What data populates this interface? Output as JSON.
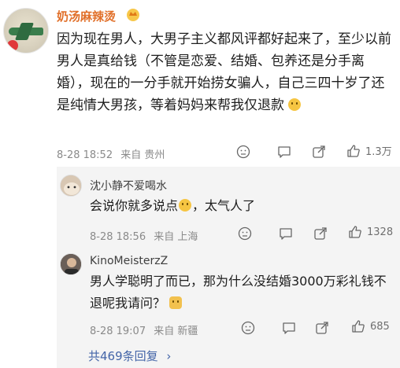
{
  "comment": {
    "username": "奶汤麻辣烫",
    "text": "因为现在男人，大男子主义都风评都好起来了，至少以前男人是真给钱（不管是恋爱、结婚、包养还是分手离婚），现在的一分手就开始捞女骗人，自己三四十岁了还是纯情大男孩，等着妈妈来帮我仅退款",
    "date": "8-28 18:52",
    "location": "来自 贵州",
    "likes": "1.3万",
    "icons": [
      "dislike-icon",
      "comment-icon",
      "share-icon",
      "like-icon"
    ]
  },
  "replies": [
    {
      "username": "沈小静不爱喝水",
      "text": "会说你就多说点",
      "text_tail": "，太气人了",
      "date": "8-28 18:56",
      "location": "来自 上海",
      "likes": "1328"
    },
    {
      "username": "KinoMeisterzZ",
      "text": "男人学聪明了而已，那为什么没结婚3000万彩礼钱不退呢我请问？",
      "date": "8-28 19:07",
      "location": "来自 新疆",
      "likes": "685"
    }
  ],
  "more_replies": "共469条回复",
  "more_chevron": "›",
  "colors": {
    "username": "#e1702a",
    "link": "#4465a8",
    "reply_bg": "#f4f4f4"
  }
}
